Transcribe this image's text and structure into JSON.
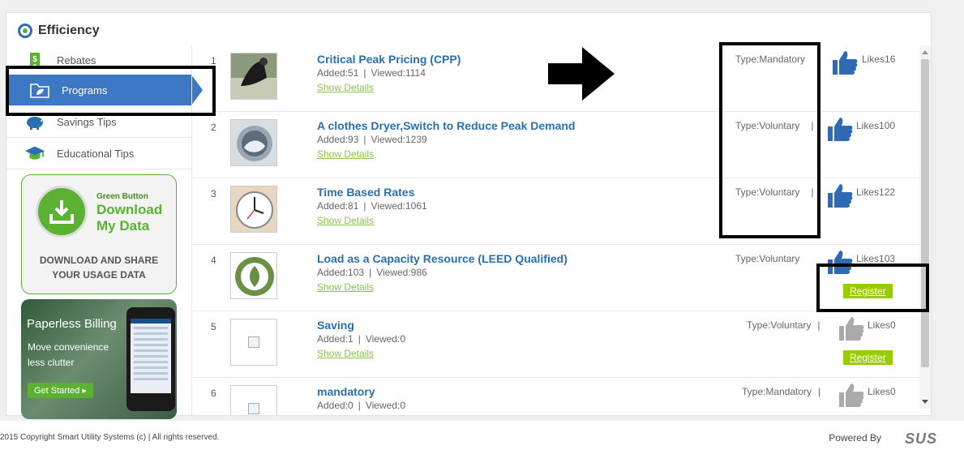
{
  "panel": {
    "title": "Efficiency"
  },
  "sidebar": {
    "items": [
      {
        "label": "Rebates",
        "icon": "rebate-tag-icon"
      },
      {
        "label": "Programs",
        "icon": "folder-leaf-icon",
        "active": true
      },
      {
        "label": "Savings Tips",
        "icon": "piggy-bank-icon"
      },
      {
        "label": "Educational Tips",
        "icon": "graduation-cap-icon"
      }
    ]
  },
  "promo_download": {
    "small": "Green Button",
    "big_line1": "Download",
    "big_line2": "My Data",
    "share_line1": "DOWNLOAD AND SHARE",
    "share_line2": "YOUR USAGE DATA"
  },
  "promo_paperless": {
    "title": "Paperless Billing",
    "sub_line1": "Move convenience",
    "sub_line2": "less clutter",
    "button": "Get Started"
  },
  "programs": [
    {
      "num": "1",
      "title": "Critical Peak Pricing (CPP)",
      "added": "Added:51",
      "viewed": "Viewed:1114",
      "details": "Show Details",
      "type": "Type:Mandatory",
      "likes": "Likes16",
      "thumb_active": true
    },
    {
      "num": "2",
      "title": "A clothes Dryer,Switch to Reduce Peak Demand",
      "added": "Added:93",
      "viewed": "Viewed:1239",
      "details": "Show Details",
      "type": "Type:Voluntary",
      "likes": "Likes100",
      "thumb_active": true
    },
    {
      "num": "3",
      "title": "Time Based Rates",
      "added": "Added:81",
      "viewed": "Viewed:1061",
      "details": "Show Details",
      "type": "Type:Voluntary",
      "likes": "Likes122",
      "thumb_active": true
    },
    {
      "num": "4",
      "title": "Load as a Capacity Resource (LEED Qualified)",
      "added": "Added:103",
      "viewed": "Viewed:986",
      "details": "Show Details",
      "type": "Type:Voluntary",
      "likes": "Likes103",
      "thumb_active": true,
      "register": "Register"
    },
    {
      "num": "5",
      "title": "Saving",
      "added": "Added:1",
      "viewed": "Viewed:0",
      "details": "Show Details",
      "type": "Type:Voluntary",
      "likes": "Likes0",
      "thumb_active": false,
      "register": "Register"
    },
    {
      "num": "6",
      "title": "mandatory",
      "added": "Added:0",
      "viewed": "Viewed:0",
      "details": "",
      "type": "Type:Mandatory",
      "likes": "Likes0",
      "thumb_active": false
    }
  ],
  "separator": "|",
  "footer": {
    "copyright": "2015 Copyright Smart Utility Systems (c) | All rights reserved.",
    "powered": "Powered By",
    "brand": "SUS"
  },
  "colors": {
    "accent_blue": "#3c78c3",
    "link_blue": "#2a6fb0",
    "green": "#5bb132",
    "register_green": "#99cc00",
    "thumb_blue": "#2f6bb5",
    "thumb_gray": "#aaaaaa"
  }
}
